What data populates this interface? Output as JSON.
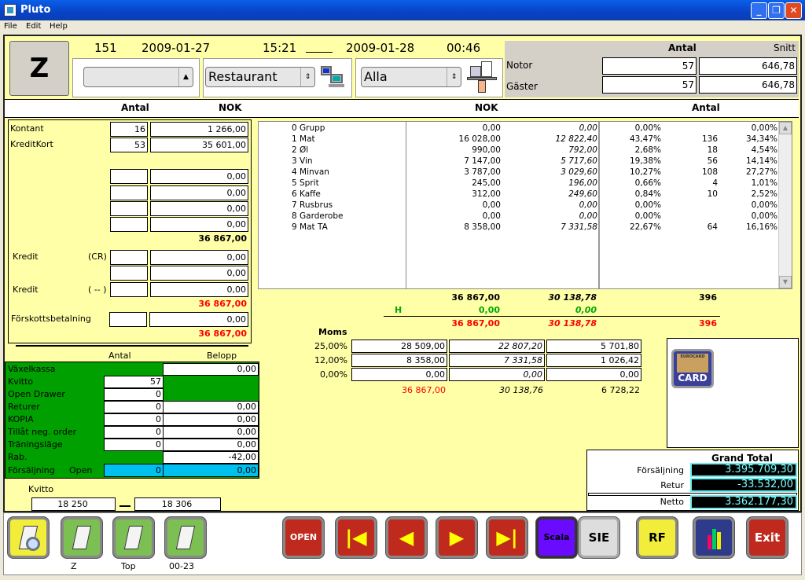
{
  "window": {
    "title": "Pluto",
    "minimize": "_",
    "maximize": "❐",
    "close": "✕"
  },
  "menu": [
    "File",
    "Edit",
    "Help"
  ],
  "header": {
    "mode": "Z",
    "number": "151",
    "start_date": "2009-01-27",
    "start_time": "15:21",
    "end_date": "2009-01-28",
    "end_time": "00:46",
    "select1": "",
    "select2": "Restaurant",
    "select3": "Alla"
  },
  "stats": {
    "col_antal": "Antal",
    "col_snitt": "Snitt",
    "rows": [
      {
        "label": "Notor",
        "antal": "57",
        "snitt": "646,78"
      },
      {
        "label": "Gäster",
        "antal": "57",
        "snitt": "646,78"
      }
    ]
  },
  "colheads": {
    "antal": "Antal",
    "nok": "NOK",
    "nok2": "NOK",
    "antal2": "Antal"
  },
  "payments": {
    "rows": [
      {
        "label": "Kontant",
        "antal": "16",
        "nok": "1 266,00"
      },
      {
        "label": "KreditKort",
        "antal": "53",
        "nok": "35 601,00"
      },
      {
        "label": "",
        "antal": "",
        "nok": "0,00"
      },
      {
        "label": "",
        "antal": "",
        "nok": "0,00"
      },
      {
        "label": "",
        "antal": "",
        "nok": "0,00"
      },
      {
        "label": "",
        "antal": "",
        "nok": "0,00"
      }
    ],
    "subtotal": "36 867,00",
    "kredit_label": "Kredit",
    "kredit_cr": "(CR)",
    "kredit_cr_value": "0,00",
    "kredit_extra_value": "0,00",
    "kredit2_label": "Kredit",
    "kredit_dash": "( -- )",
    "kredit_dash_value": "0,00",
    "total2": "36 867,00",
    "forskott_label": "Förskottsbetalning",
    "forskott_value": "0,00",
    "total3": "36 867,00"
  },
  "groups": [
    {
      "name": "0 Grupp",
      "nok": "0,00",
      "net": "0,00",
      "pct": "0,00%",
      "antal": "",
      "pct2": "0,00%"
    },
    {
      "name": "1 Mat",
      "nok": "16 028,00",
      "net": "12 822,40",
      "pct": "43,47%",
      "antal": "136",
      "pct2": "34,34%"
    },
    {
      "name": "2 Øl",
      "nok": "990,00",
      "net": "792,00",
      "pct": "2,68%",
      "antal": "18",
      "pct2": "4,54%"
    },
    {
      "name": "3 Vin",
      "nok": "7 147,00",
      "net": "5 717,60",
      "pct": "19,38%",
      "antal": "56",
      "pct2": "14,14%"
    },
    {
      "name": "4 Minvan",
      "nok": "3 787,00",
      "net": "3 029,60",
      "pct": "10,27%",
      "antal": "108",
      "pct2": "27,27%"
    },
    {
      "name": "5 Sprit",
      "nok": "245,00",
      "net": "196,00",
      "pct": "0,66%",
      "antal": "4",
      "pct2": "1,01%"
    },
    {
      "name": "6 Kaffe",
      "nok": "312,00",
      "net": "249,60",
      "pct": "0,84%",
      "antal": "10",
      "pct2": "2,52%"
    },
    {
      "name": "7 Rusbrus",
      "nok": "0,00",
      "net": "0,00",
      "pct": "0,00%",
      "antal": "",
      "pct2": "0,00%"
    },
    {
      "name": "8 Garderobe",
      "nok": "0,00",
      "net": "0,00",
      "pct": "0,00%",
      "antal": "",
      "pct2": "0,00%"
    },
    {
      "name": "9 Mat TA",
      "nok": "8 358,00",
      "net": "7 331,58",
      "pct": "22,67%",
      "antal": "64",
      "pct2": "16,16%"
    }
  ],
  "totals": {
    "nok": "36 867,00",
    "net": "30 138,78",
    "antal": "396",
    "h_label": "H",
    "h_nok": "0,00",
    "h_net": "0,00",
    "final_nok": "36 867,00",
    "final_net": "30 138,78",
    "final_antal": "396"
  },
  "moms": {
    "label": "Moms",
    "rows": [
      {
        "rate": "25,00%",
        "gross": "28 509,00",
        "net": "22 807,20",
        "vat": "5 701,80"
      },
      {
        "rate": "12,00%",
        "gross": "8 358,00",
        "net": "7 331,58",
        "vat": "1 026,42"
      },
      {
        "rate": "0,00%",
        "gross": "0,00",
        "net": "0,00",
        "vat": "0,00"
      }
    ],
    "total_gross": "36 867,00",
    "total_net": "30 138,76",
    "total_vat": "6 728,22"
  },
  "card": {
    "label": "CARD",
    "brand": "EUROCARD"
  },
  "grand": {
    "title": "Grand Total",
    "rows": [
      {
        "label": "Försäljning",
        "value": "3.395.709,30"
      },
      {
        "label": "Retur",
        "value": "-33.532,00"
      },
      {
        "label": "Netto",
        "value": "3.362.177,30"
      }
    ]
  },
  "drawer": {
    "col_antal": "Antal",
    "col_belopp": "Belopp",
    "rows": [
      {
        "label": "Växelkassa",
        "antal": null,
        "belopp": "0,00"
      },
      {
        "label": "Kvitto",
        "antal": "57",
        "belopp": null
      },
      {
        "label": "Open Drawer",
        "antal": "0",
        "belopp": null
      },
      {
        "label": "Returer",
        "antal": "0",
        "belopp": "0,00"
      },
      {
        "label": "KOPIA",
        "antal": "0",
        "belopp": "0,00"
      },
      {
        "label": "Tillåt neg. order",
        "antal": "0",
        "belopp": "0,00"
      },
      {
        "label": "Träningsläge",
        "antal": "0",
        "belopp": "0,00"
      },
      {
        "label": "Rab.",
        "antal": null,
        "belopp": "-42,00"
      }
    ],
    "sale_label": "Försäljning",
    "sale_status": "Open",
    "sale_antal": "0",
    "sale_belopp": "0,00"
  },
  "kvitto": {
    "label": "Kvitto",
    "from": "18 250",
    "to": "18 306"
  },
  "toolbar": {
    "z": "Z",
    "top": "Top",
    "hours": "00-23",
    "open": "OPEN",
    "scala": "Scala",
    "sie": "SIE",
    "rf": "RF",
    "exit": "Exit"
  },
  "colors": {
    "background": "#ffffa8",
    "green_panel": "#00a000",
    "highlight": "#00c0f0",
    "title_bar": "#0842c6"
  }
}
